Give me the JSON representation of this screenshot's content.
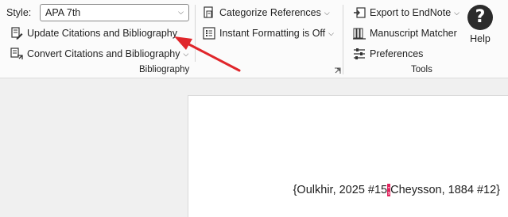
{
  "ribbon": {
    "style_label": "Style:",
    "style_value": "APA 7th",
    "bibliography": {
      "update_label": "Update Citations and Bibliography",
      "convert_label": "Convert Citations and Bibliography",
      "group_title": "Bibliography"
    },
    "middle": {
      "categorize_label": "Categorize References",
      "instant_label": "Instant Formatting is Off"
    },
    "tools": {
      "export_label": "Export to EndNote",
      "matcher_label": "Manuscript Matcher",
      "preferences_label": "Preferences",
      "group_title": "Tools"
    },
    "help_label": "Help"
  },
  "document": {
    "citation_before": "{Oulkhir, 2025 #15",
    "citation_separator": ";",
    "citation_after": "Cheysson, 1884 #12}"
  },
  "colors": {
    "annotation_arrow": "#e0262b",
    "cursor_highlight": "#e0245e"
  }
}
